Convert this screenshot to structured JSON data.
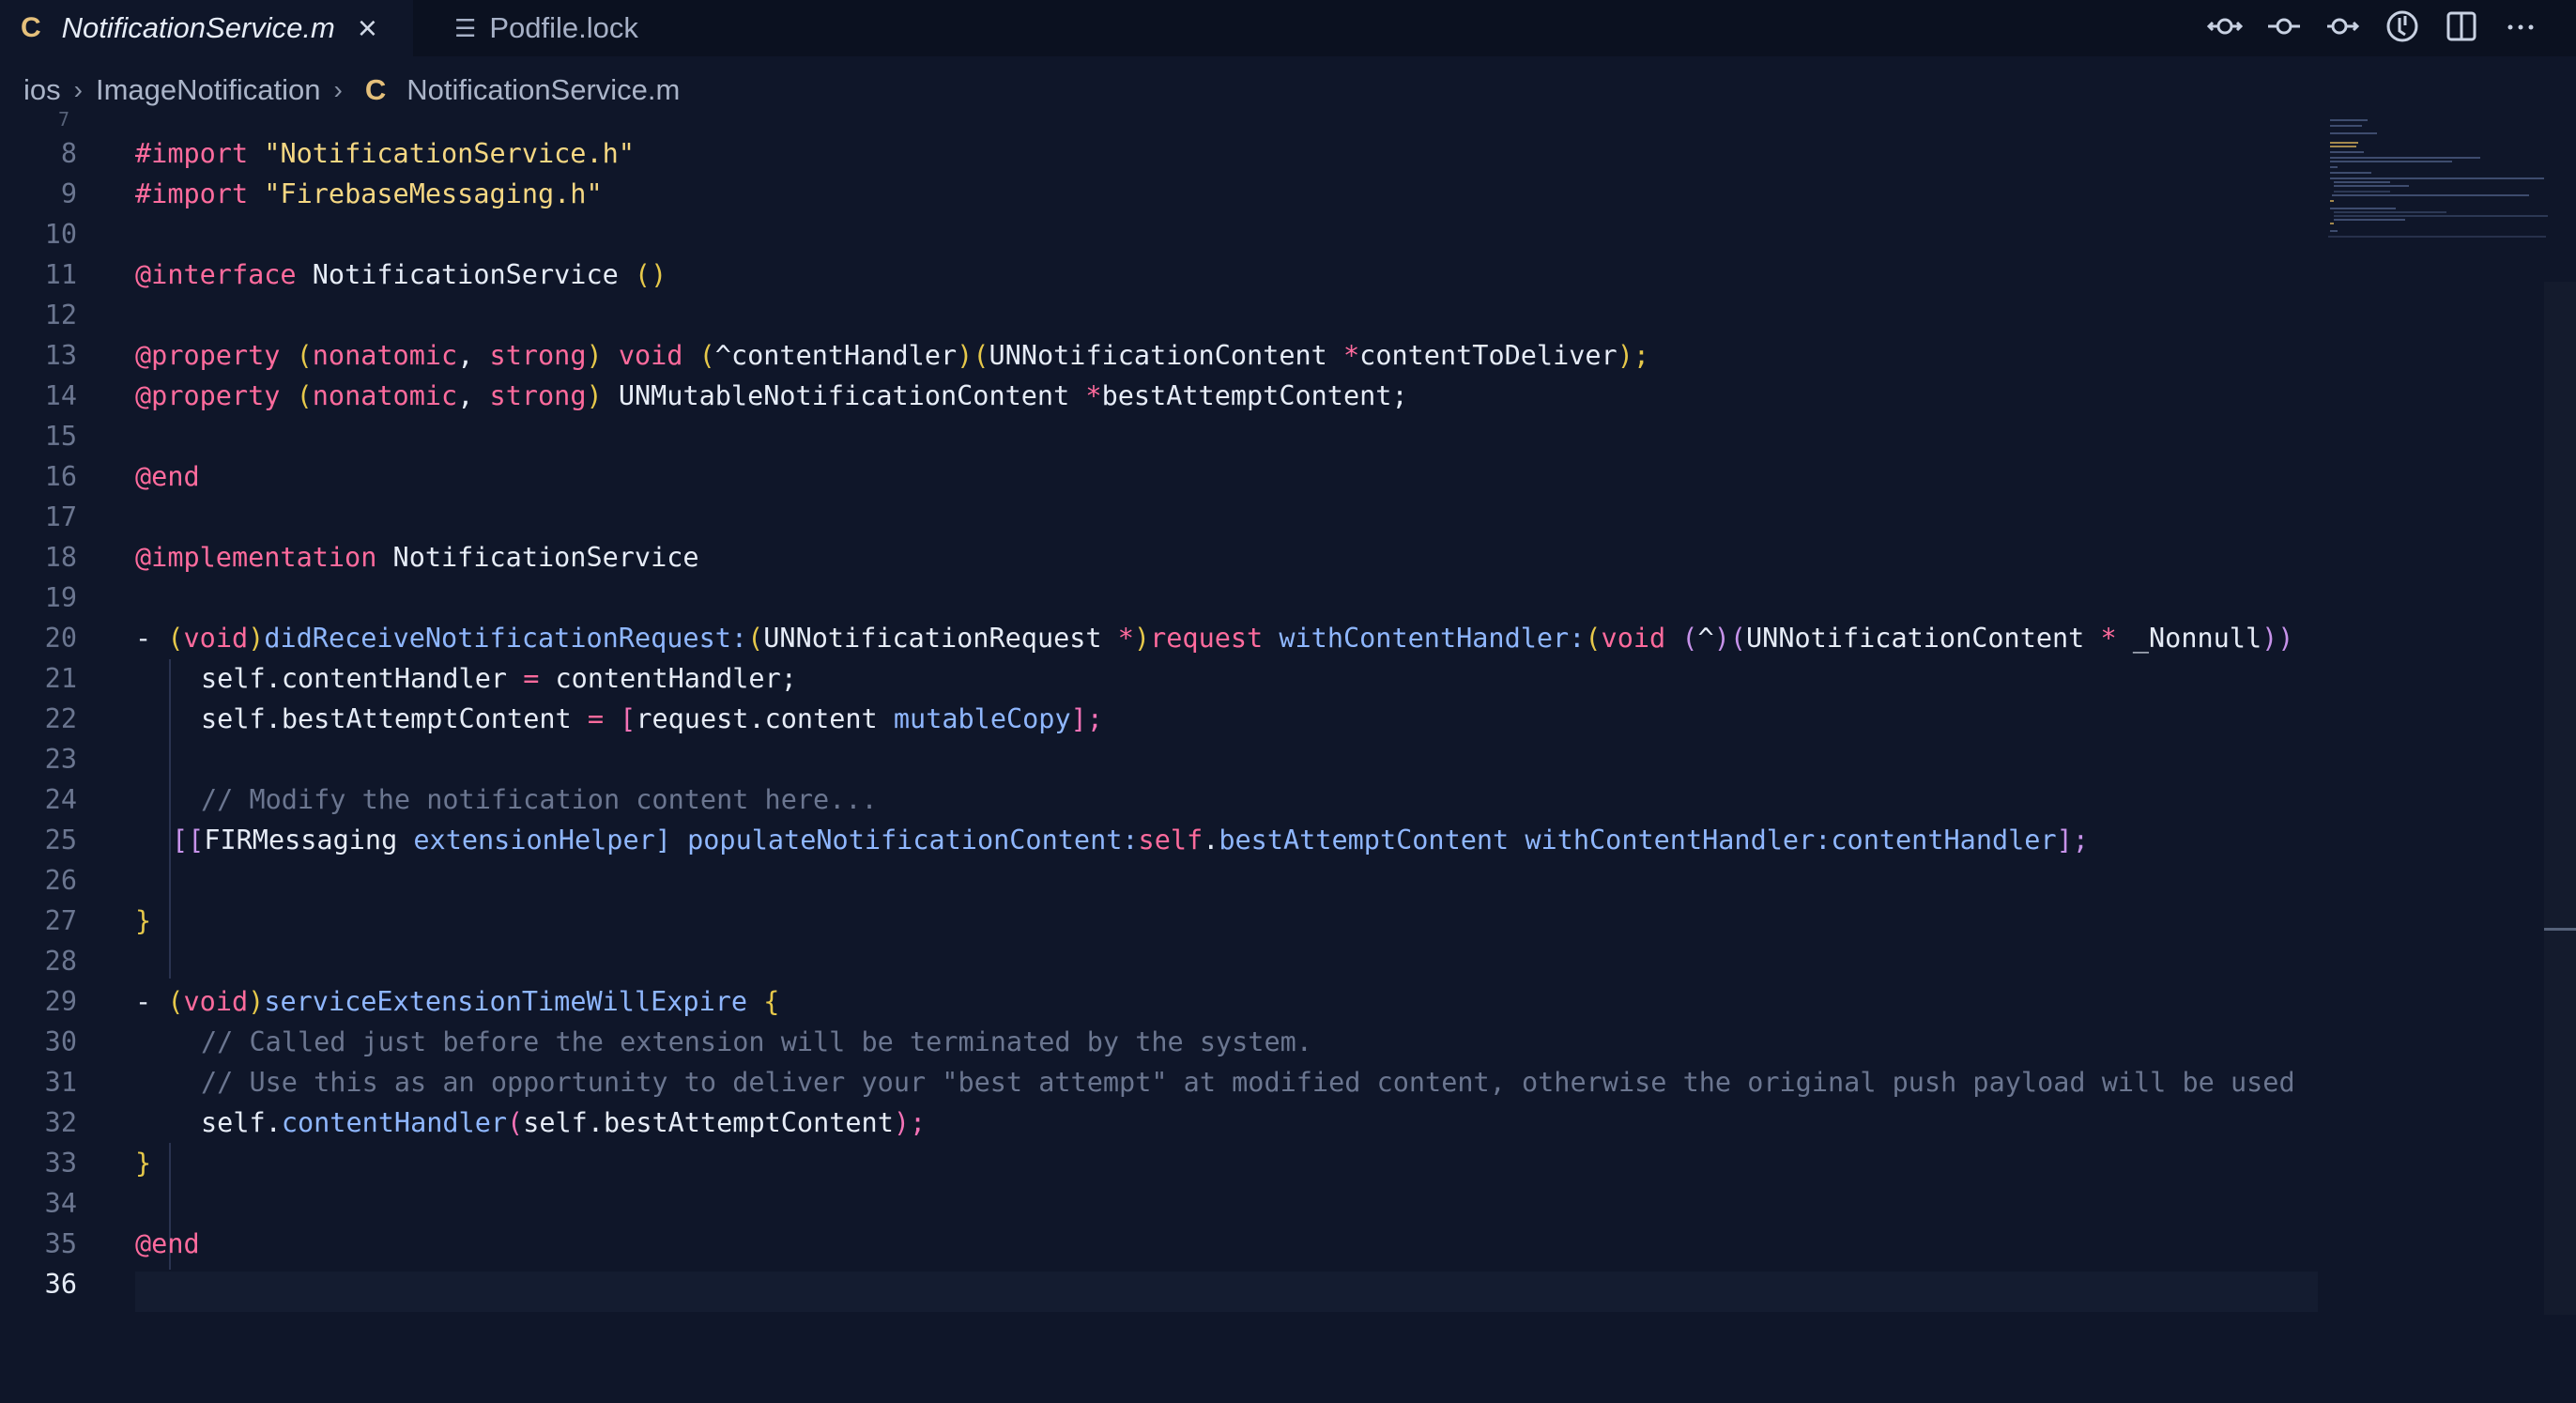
{
  "tabs": [
    {
      "label": "NotificationService.m",
      "icon": "C",
      "active": true
    },
    {
      "label": "Podfile.lock",
      "icon": "file-lines-icon",
      "active": false
    }
  ],
  "actions": [
    "git-compare-icon",
    "git-commit-icon",
    "git-push-icon",
    "timeline-icon",
    "split-editor-icon",
    "more-icon"
  ],
  "breadcrumb": [
    "ios",
    "ImageNotification",
    "NotificationService.m"
  ],
  "editor": {
    "first_line_partial": "7",
    "current_line": 36,
    "line_numbers": [
      "8",
      "9",
      "10",
      "11",
      "12",
      "13",
      "14",
      "15",
      "16",
      "17",
      "18",
      "19",
      "20",
      "21",
      "22",
      "23",
      "24",
      "25",
      "26",
      "27",
      "28",
      "29",
      "30",
      "31",
      "32",
      "33",
      "34",
      "35",
      "36"
    ],
    "lines": {
      "l8": [
        "#import ",
        "\"NotificationService.h\""
      ],
      "l9": [
        "#import ",
        "\"FirebaseMessaging.h\""
      ],
      "l11": [
        "@interface",
        " NotificationService ",
        "()"
      ],
      "l13": [
        "@property",
        " (",
        "nonatomic",
        ", ",
        "strong",
        ") ",
        "void",
        " (",
        "^contentHandler",
        ")(",
        "UNNotificationContent ",
        "*",
        "contentToDeliver",
        ");"
      ],
      "l14": [
        "@property",
        " (",
        "nonatomic",
        ", ",
        "strong",
        ") ",
        "UNMutableNotificationContent ",
        "*",
        "bestAttemptContent",
        ";"
      ],
      "l16": [
        "@end"
      ],
      "l18": [
        "@implementation",
        " NotificationService"
      ],
      "l20": [
        "- ",
        "(",
        "void",
        ")",
        "didReceiveNotificationRequest:",
        "(",
        "UNNotificationRequest ",
        "*",
        ")",
        "request",
        " withContentHandler:",
        "(",
        "void",
        " (",
        "^",
        ")(",
        "UNNotificationContent ",
        "*",
        " _Nonnull",
        "))"
      ],
      "l21": [
        "self",
        ".",
        "contentHandler",
        " = ",
        "contentHandler",
        ";"
      ],
      "l22": [
        "self",
        ".",
        "bestAttemptContent",
        " = ",
        "[",
        "request",
        ".",
        "content",
        " mutableCopy",
        "];"
      ],
      "l24": [
        "// Modify the notification content here..."
      ],
      "l25": [
        "[[",
        "FIRMessaging",
        " extensionHelper",
        "] ",
        "populateNotificationContent:",
        "self",
        ".",
        "bestAttemptContent",
        " withContentHandler:",
        "contentHandler",
        "];"
      ],
      "l27": [
        "}"
      ],
      "l29": [
        "- ",
        "(",
        "void",
        ")",
        "serviceExtensionTimeWillExpire",
        " {"
      ],
      "l30": [
        "// Called just before the extension will be terminated by the system."
      ],
      "l31": [
        "// Use this as an opportunity to deliver your \"best attempt\" at modified content, otherwise the original push payload will be used"
      ],
      "l32": [
        "self",
        ".",
        "contentHandler",
        "(",
        "self",
        ".",
        "bestAttemptContent",
        ");"
      ],
      "l33": [
        "}"
      ],
      "l35": [
        "@end"
      ]
    }
  }
}
